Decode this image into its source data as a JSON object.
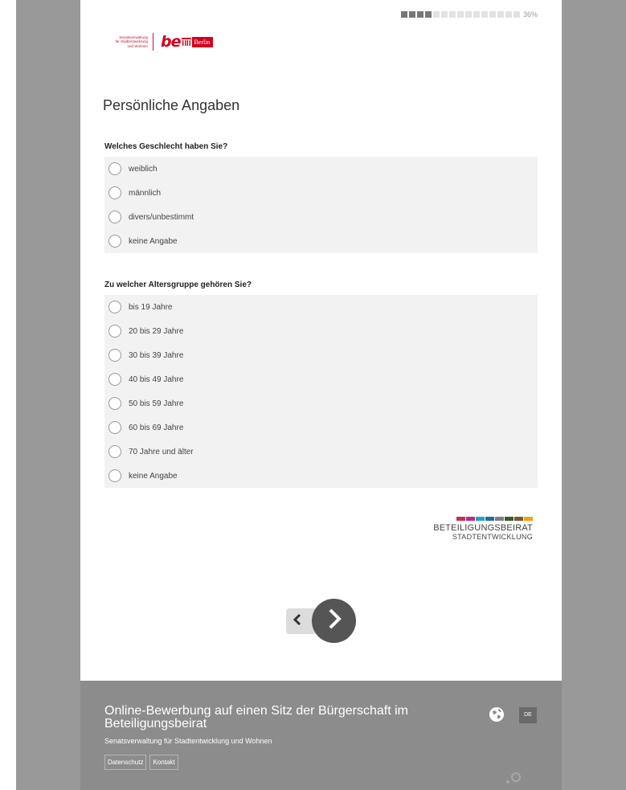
{
  "progress": {
    "percent_label": "36%",
    "segments_total": 15,
    "segments_filled": 4,
    "fraction": 0.36
  },
  "logo": {
    "dept_text": "Senatsverwaltung\nfür Stadtentwicklung\nund Wohnen",
    "be_text": "be",
    "berlin_text": "Berlin"
  },
  "page_title": "Persönliche Angaben",
  "questions": [
    {
      "label": "Welches Geschlecht haben Sie?",
      "options": [
        "weiblich",
        "männlich",
        "divers/unbestimmt",
        "keine Angabe"
      ]
    },
    {
      "label": "Zu welcher Altersgruppe gehören Sie?",
      "options": [
        "bis 19 Jahre",
        "20 bis 29 Jahre",
        "30 bis 39 Jahre",
        "40 bis 49 Jahre",
        "50 bis 59 Jahre",
        "60 bis 69 Jahre",
        "70 Jahre und älter",
        "keine Angabe"
      ]
    }
  ],
  "beirat": {
    "line1": "BETEILIGUNGSBEIRAT",
    "line2": "STADTENTWICKLUNG",
    "stripe_colors": [
      "#c0324c",
      "#c0288e",
      "#1ba5c9",
      "#1f6f9a",
      "#837a8f",
      "#3b5a27",
      "#7a5a2a",
      "#f2a114"
    ]
  },
  "nav": {
    "prev_icon": "chevron-left-icon",
    "next_icon": "chevron-right-icon"
  },
  "footer": {
    "title": "Online-Bewerbung auf einen Sitz der Bürgerschaft im Beteiligungsbeirat",
    "subtitle": "Senatsverwaltung für Stadtentwicklung und Wohnen",
    "links": [
      "Datenschutz",
      "Kontakt"
    ],
    "language": "DE",
    "globe_icon": "globe-icon"
  },
  "colors": {
    "side_bg": "#999999",
    "footer_bg": "#8c8c8c",
    "berlin_red": "#d2001e"
  }
}
